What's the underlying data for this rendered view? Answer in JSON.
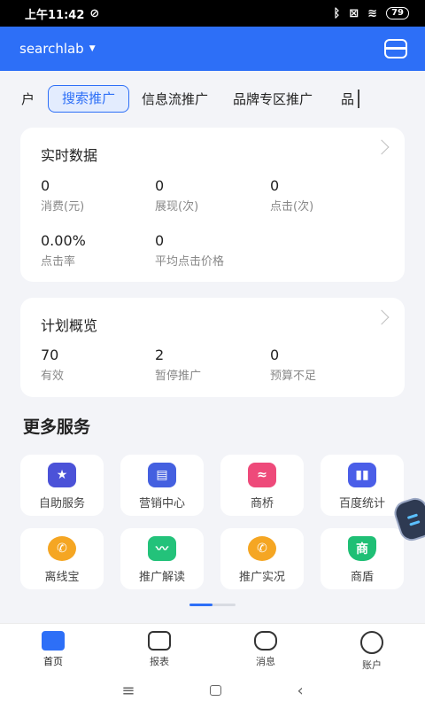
{
  "status_bar": {
    "time": "上午11:42",
    "battery": "79"
  },
  "header": {
    "account": "searchlab"
  },
  "tabs": [
    "户",
    "搜索推广",
    "信息流推广",
    "品牌专区推广",
    "品"
  ],
  "realtime": {
    "title": "实时数据",
    "stats": [
      {
        "value": "0",
        "label": "消费(元)"
      },
      {
        "value": "0",
        "label": "展现(次)"
      },
      {
        "value": "0",
        "label": "点击(次)"
      },
      {
        "value": "0.00%",
        "label": "点击率"
      },
      {
        "value": "0",
        "label": "平均点击价格"
      }
    ]
  },
  "plan": {
    "title": "计划概览",
    "stats": [
      {
        "value": "70",
        "label": "有效"
      },
      {
        "value": "2",
        "label": "暂停推广"
      },
      {
        "value": "0",
        "label": "预算不足"
      }
    ]
  },
  "services": {
    "title": "更多服务",
    "items": [
      {
        "label": "自助服务",
        "icon": "star-hexagon-icon",
        "color": "#4b52d8"
      },
      {
        "label": "营销中心",
        "icon": "book-icon",
        "color": "#4460e0"
      },
      {
        "label": "商桥",
        "icon": "bear-icon",
        "color": "#ee4a7a"
      },
      {
        "label": "百度统计",
        "icon": "bar-chart-icon",
        "color": "#4a5ee8"
      },
      {
        "label": "离线宝",
        "icon": "phone-icon",
        "color": "#f5a623"
      },
      {
        "label": "推广解读",
        "icon": "trend-chart-icon",
        "color": "#23c27a"
      },
      {
        "label": "推广实况",
        "icon": "phone-icon",
        "color": "#f5a623"
      },
      {
        "label": "商盾",
        "icon": "shield-icon",
        "color": "#1fbf75",
        "glyph": "商"
      }
    ]
  },
  "bottom_nav": [
    "首页",
    "报表",
    "消息",
    "账户"
  ]
}
